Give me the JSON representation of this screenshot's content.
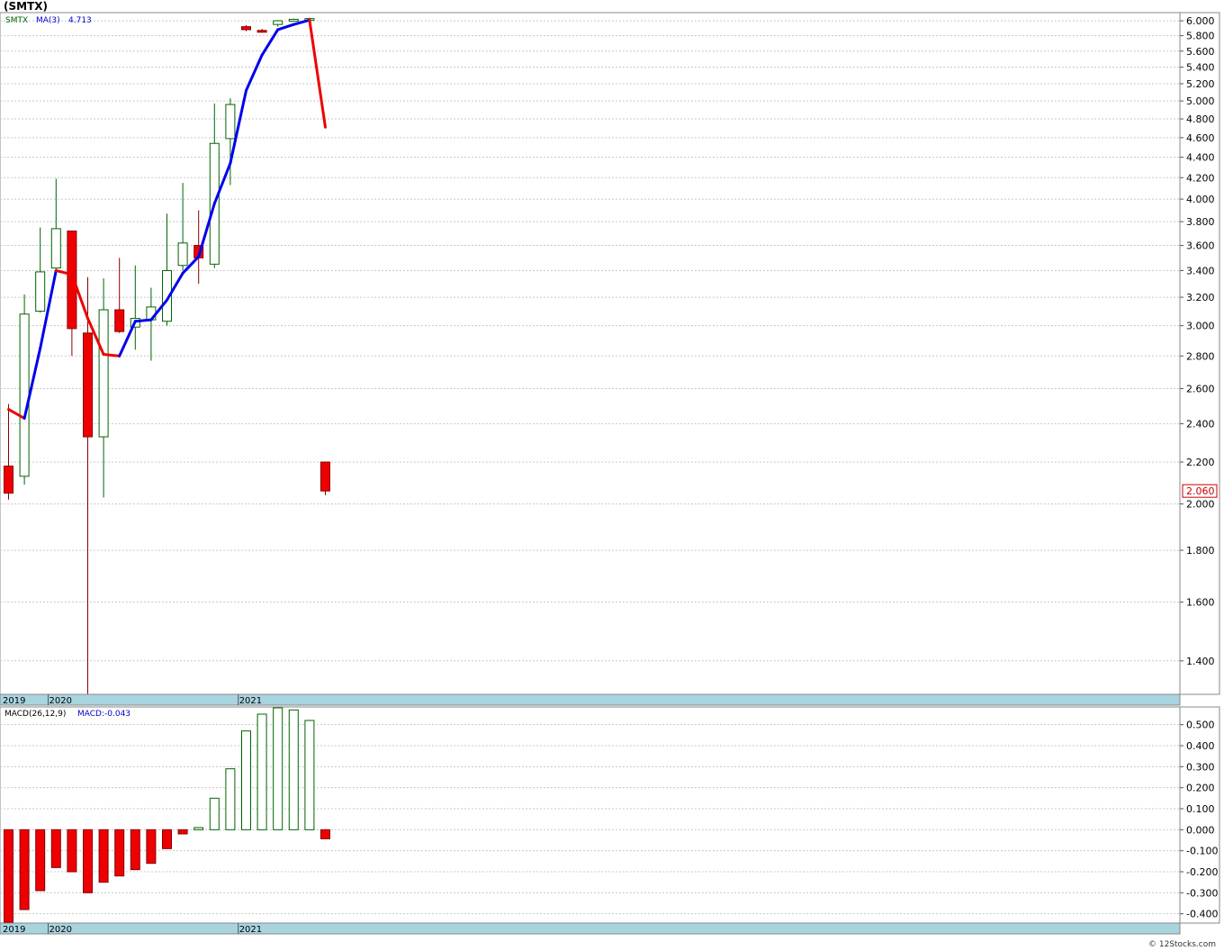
{
  "title": "(SMTX)",
  "footer": "© 12Stocks.com",
  "chart_data": [
    {
      "type": "candlestick",
      "name": "price-panel",
      "legend": {
        "symbol": "SMTX",
        "ma_label": "MA(3)",
        "ma_value": "4.713"
      },
      "last_price_label": "2.060",
      "scale": "log",
      "ylim": [
        1.3,
        6.1
      ],
      "yticks": [
        "6.000",
        "5.800",
        "5.600",
        "5.400",
        "5.200",
        "5.000",
        "4.800",
        "4.600",
        "4.400",
        "4.200",
        "4.000",
        "3.800",
        "3.600",
        "3.400",
        "3.200",
        "3.000",
        "2.800",
        "2.600",
        "2.400",
        "2.200",
        "2.000",
        "1.800",
        "1.600",
        "1.400"
      ],
      "year_labels": [
        {
          "label": "2019",
          "index": 0
        },
        {
          "label": "2020",
          "index": 3
        },
        {
          "label": "2021",
          "index": 15
        }
      ],
      "candles": [
        {
          "open": 2.18,
          "high": 2.51,
          "low": 2.02,
          "close": 2.05
        },
        {
          "open": 2.13,
          "high": 3.22,
          "low": 2.09,
          "close": 3.08
        },
        {
          "open": 3.1,
          "high": 3.75,
          "low": 3.09,
          "close": 3.39
        },
        {
          "open": 3.42,
          "high": 4.19,
          "low": 3.38,
          "close": 3.74
        },
        {
          "open": 3.72,
          "high": 3.72,
          "low": 2.8,
          "close": 2.98
        },
        {
          "open": 2.95,
          "high": 3.35,
          "low": 1.27,
          "close": 2.33
        },
        {
          "open": 2.33,
          "high": 3.34,
          "low": 2.03,
          "close": 3.11
        },
        {
          "open": 3.11,
          "high": 3.5,
          "low": 2.95,
          "close": 2.96
        },
        {
          "open": 2.99,
          "high": 3.44,
          "low": 2.84,
          "close": 3.05
        },
        {
          "open": 3.04,
          "high": 3.27,
          "low": 2.77,
          "close": 3.13
        },
        {
          "open": 3.03,
          "high": 3.87,
          "low": 3.0,
          "close": 3.4
        },
        {
          "open": 3.44,
          "high": 4.15,
          "low": 3.4,
          "close": 3.62
        },
        {
          "open": 3.6,
          "high": 3.9,
          "low": 3.3,
          "close": 3.5
        },
        {
          "open": 3.45,
          "high": 4.97,
          "low": 3.42,
          "close": 4.54
        },
        {
          "open": 4.59,
          "high": 5.03,
          "low": 4.13,
          "close": 4.96
        },
        {
          "open": 5.92,
          "high": 5.94,
          "low": 5.86,
          "close": 5.88
        },
        {
          "open": 5.87,
          "high": 5.89,
          "low": 5.84,
          "close": 5.86
        },
        {
          "open": 5.95,
          "high": 6.01,
          "low": 5.92,
          "close": 6.0
        },
        {
          "open": 6.01,
          "high": 6.03,
          "low": 5.99,
          "close": 6.02
        },
        {
          "open": 6.02,
          "high": 6.04,
          "low": 6.0,
          "close": 6.03
        },
        {
          "open": 2.2,
          "high": 2.2,
          "low": 2.04,
          "close": 2.06
        }
      ],
      "ma": [
        2.48,
        2.43,
        2.85,
        3.4,
        3.37,
        3.05,
        2.81,
        2.8,
        3.03,
        3.04,
        3.18,
        3.38,
        3.51,
        3.96,
        4.34,
        5.12,
        5.55,
        5.88,
        5.95,
        6.01,
        4.71
      ],
      "colors": {
        "up": "#ffffff",
        "up_border": "#006400",
        "down": "#ee0000",
        "down_border": "#880000",
        "ma_rising": "#0000ee",
        "ma_falling": "#ee0000"
      }
    },
    {
      "type": "bar",
      "name": "macd-panel",
      "legend": {
        "label": "MACD(26,12,9)",
        "value_label": "MACD:-0.043"
      },
      "ylim": [
        -0.44,
        0.58
      ],
      "yticks": [
        "0.500",
        "0.400",
        "0.300",
        "0.200",
        "0.100",
        "0.000",
        "-0.100",
        "-0.200",
        "-0.300",
        "-0.400"
      ],
      "year_labels": [
        {
          "label": "2019",
          "index": 0
        },
        {
          "label": "2020",
          "index": 3
        },
        {
          "label": "2021",
          "index": 15
        }
      ],
      "values": [
        -0.44,
        -0.38,
        -0.29,
        -0.18,
        -0.2,
        -0.3,
        -0.25,
        -0.22,
        -0.19,
        -0.16,
        -0.09,
        -0.02,
        0.01,
        0.15,
        0.29,
        0.47,
        0.55,
        0.58,
        0.57,
        0.52,
        -0.043
      ],
      "colors": {
        "positive": "#ffffff",
        "positive_border": "#006400",
        "negative": "#ee0000",
        "negative_border": "#880000"
      }
    }
  ]
}
